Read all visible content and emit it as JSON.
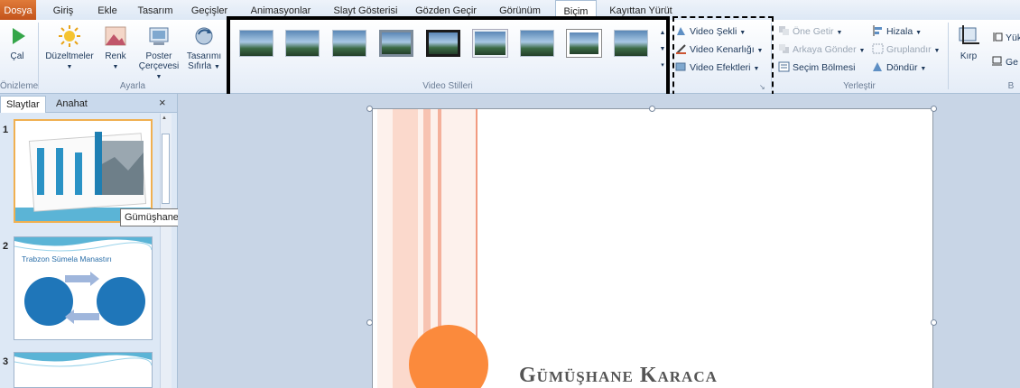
{
  "tabs": {
    "file": "Dosya",
    "items": [
      {
        "label": "Giriş"
      },
      {
        "label": "Ekle"
      },
      {
        "label": "Tasarım"
      },
      {
        "label": "Geçişler"
      },
      {
        "label": "Animasyonlar"
      },
      {
        "label": "Slayt Gösterisi"
      },
      {
        "label": "Gözden Geçir"
      },
      {
        "label": "Görünüm"
      },
      {
        "label": "Biçim",
        "active": true
      },
      {
        "label": "Kayıttan Yürüt"
      }
    ]
  },
  "ribbon": {
    "preview": {
      "play": "Çal",
      "group": "Önizleme"
    },
    "adjust": {
      "corrections": "Düzeltmeler",
      "color": "Renk",
      "poster_1": "Poster",
      "poster_2": "Çerçevesi",
      "reset_1": "Tasarımı",
      "reset_2": "Sıfırla",
      "group": "Ayarla"
    },
    "video_styles": {
      "group": "Video Stilleri",
      "shape": "Video Şekli",
      "border": "Video Kenarlığı",
      "effects": "Video Efektleri"
    },
    "arrange": {
      "bring_forward": "Öne Getir",
      "send_backward": "Arkaya Gönder",
      "selection_pane": "Seçim Bölmesi",
      "align": "Hizala",
      "group_btn": "Gruplandır",
      "rotate": "Döndür",
      "group": "Yerleştir"
    },
    "size": {
      "crop": "Kırp",
      "height_prefix": "Yük",
      "width_prefix": "Ge"
    }
  },
  "panel": {
    "tab_slides": "Slaytlar",
    "tab_outline": "Anahat",
    "close": "×",
    "slides": [
      {
        "num": "1"
      },
      {
        "num": "2",
        "title": "Trabzon Sümela Manastırı"
      },
      {
        "num": "3"
      }
    ],
    "tooltip": "Gümüşhane Karaca Mağaraları"
  },
  "slide": {
    "title": "Gümüşhane Karaca"
  },
  "colors": {
    "accent_orange": "#fb8a3c",
    "ribbon_blue": "#1e395b"
  }
}
